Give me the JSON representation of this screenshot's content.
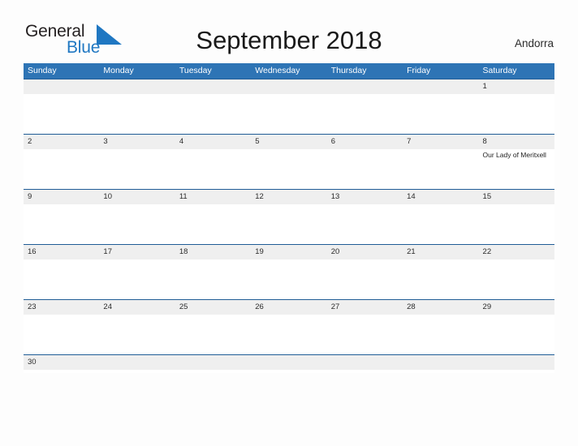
{
  "brand": {
    "logo_primary": "General",
    "logo_secondary": "Blue",
    "flag_icon": "triangle-flag-icon",
    "flag_color": "#1f77c2"
  },
  "header": {
    "title": "September 2018",
    "country": "Andorra"
  },
  "theme": {
    "header_blue": "#2e74b5",
    "row_divider_blue": "#1f5c96",
    "daynum_band_gray": "#efefef",
    "page_background": "#fdfdfd",
    "text_dark": "#231f20",
    "logo_blue": "#1f77c2"
  },
  "calendar": {
    "month": "September",
    "year": "2018",
    "weekdays": [
      "Sunday",
      "Monday",
      "Tuesday",
      "Wednesday",
      "Thursday",
      "Friday",
      "Saturday"
    ],
    "weeks": [
      {
        "days": [
          {
            "date": "",
            "event": ""
          },
          {
            "date": "",
            "event": ""
          },
          {
            "date": "",
            "event": ""
          },
          {
            "date": "",
            "event": ""
          },
          {
            "date": "",
            "event": ""
          },
          {
            "date": "",
            "event": ""
          },
          {
            "date": "1",
            "event": ""
          }
        ]
      },
      {
        "days": [
          {
            "date": "2",
            "event": ""
          },
          {
            "date": "3",
            "event": ""
          },
          {
            "date": "4",
            "event": ""
          },
          {
            "date": "5",
            "event": ""
          },
          {
            "date": "6",
            "event": ""
          },
          {
            "date": "7",
            "event": ""
          },
          {
            "date": "8",
            "event": "Our Lady of Meritxell"
          }
        ]
      },
      {
        "days": [
          {
            "date": "9",
            "event": ""
          },
          {
            "date": "10",
            "event": ""
          },
          {
            "date": "11",
            "event": ""
          },
          {
            "date": "12",
            "event": ""
          },
          {
            "date": "13",
            "event": ""
          },
          {
            "date": "14",
            "event": ""
          },
          {
            "date": "15",
            "event": ""
          }
        ]
      },
      {
        "days": [
          {
            "date": "16",
            "event": ""
          },
          {
            "date": "17",
            "event": ""
          },
          {
            "date": "18",
            "event": ""
          },
          {
            "date": "19",
            "event": ""
          },
          {
            "date": "20",
            "event": ""
          },
          {
            "date": "21",
            "event": ""
          },
          {
            "date": "22",
            "event": ""
          }
        ]
      },
      {
        "days": [
          {
            "date": "23",
            "event": ""
          },
          {
            "date": "24",
            "event": ""
          },
          {
            "date": "25",
            "event": ""
          },
          {
            "date": "26",
            "event": ""
          },
          {
            "date": "27",
            "event": ""
          },
          {
            "date": "28",
            "event": ""
          },
          {
            "date": "29",
            "event": ""
          }
        ]
      },
      {
        "days": [
          {
            "date": "30",
            "event": ""
          },
          {
            "date": "",
            "event": ""
          },
          {
            "date": "",
            "event": ""
          },
          {
            "date": "",
            "event": ""
          },
          {
            "date": "",
            "event": ""
          },
          {
            "date": "",
            "event": ""
          },
          {
            "date": "",
            "event": ""
          }
        ]
      }
    ]
  }
}
